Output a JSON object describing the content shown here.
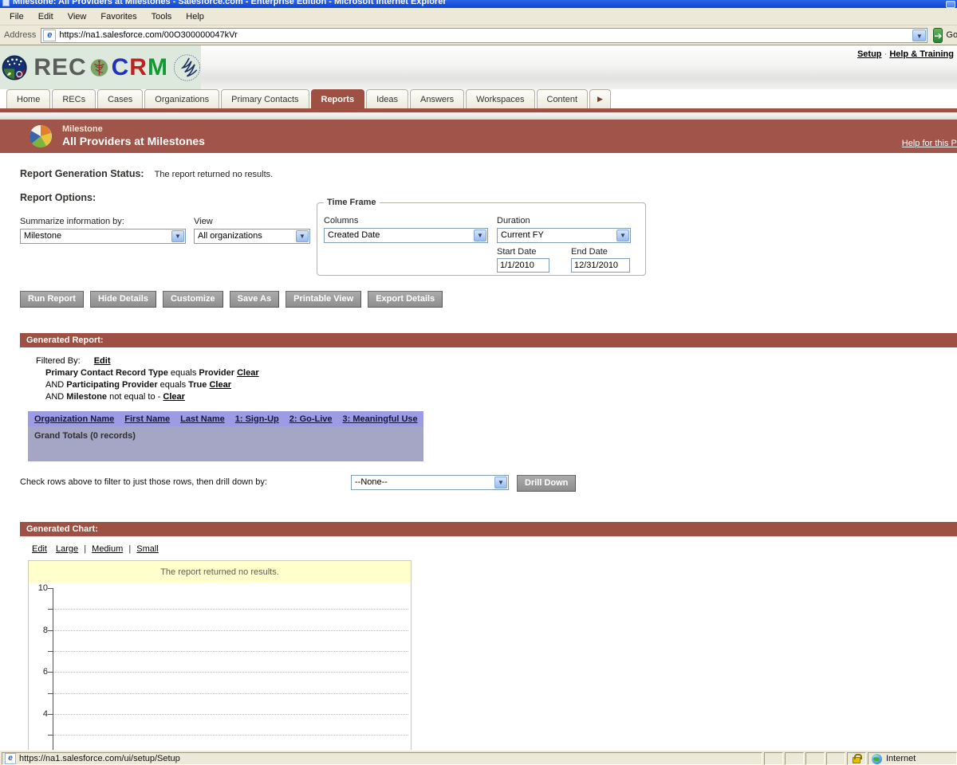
{
  "window": {
    "title": "Milestone: All Providers at Milestones - Salesforce.com - Enterprise Edition - Microsoft Internet Explorer",
    "menu_items": [
      "File",
      "Edit",
      "View",
      "Favorites",
      "Tools",
      "Help"
    ],
    "address_label": "Address",
    "address_url": "https://na1.salesforce.com/00O300000047kVr",
    "go_label": "Go"
  },
  "header": {
    "logo_rec": "REC",
    "logo_crm_c": "C",
    "logo_crm_r": "R",
    "logo_crm_m": "M",
    "setup_link": "Setup",
    "link_sep": "·",
    "help_training_link": "Help & Training"
  },
  "tabs": [
    {
      "label": "Home"
    },
    {
      "label": "RECs"
    },
    {
      "label": "Cases"
    },
    {
      "label": "Organizations"
    },
    {
      "label": "Primary Contacts"
    },
    {
      "label": "Reports"
    },
    {
      "label": "Ideas"
    },
    {
      "label": "Answers"
    },
    {
      "label": "Workspaces"
    },
    {
      "label": "Content"
    }
  ],
  "tabs_more_arrow": "▶",
  "banner": {
    "category": "Milestone",
    "title": "All Providers at Milestones",
    "help_link": "Help for this Pa"
  },
  "status_section": {
    "label": "Report Generation Status:",
    "value": "The report returned no results."
  },
  "report_options": {
    "heading": "Report Options:",
    "summarize_label": "Summarize information by:",
    "summarize_value": "Milestone",
    "view_label": "View",
    "view_value": "All organizations",
    "timeframe_legend": "Time Frame",
    "columns_label": "Columns",
    "columns_value": "Created Date",
    "duration_label": "Duration",
    "duration_value": "Current FY",
    "start_date_label": "Start Date",
    "start_date_value": "1/1/2010",
    "end_date_label": "End Date",
    "end_date_value": "12/31/2010"
  },
  "toolbar": {
    "buttons": [
      "Run Report",
      "Hide Details",
      "Customize",
      "Save As",
      "Printable View",
      "Export Details"
    ]
  },
  "generated_report": {
    "heading": "Generated Report:",
    "filtered_by_label": "Filtered By:",
    "edit_link": "Edit",
    "filters": [
      {
        "prefix": "",
        "field": "Primary Contact Record Type",
        "op": "equals",
        "value": "Provider",
        "clear": "Clear"
      },
      {
        "prefix": "AND",
        "field": "Participating Provider",
        "op": "equals",
        "value": "True",
        "clear": "Clear"
      },
      {
        "prefix": "AND",
        "field": "Milestone",
        "op": "not equal to -",
        "value": "",
        "clear": "Clear"
      }
    ],
    "table": {
      "columns": [
        "Organization Name",
        "First Name",
        "Last Name",
        "1: Sign-Up",
        "2: Go-Live",
        "3: Meaningful Use"
      ],
      "grand_totals": "Grand Totals (0 records)"
    },
    "drill": {
      "text": "Check rows above to filter to just those rows, then drill down by:",
      "select_value": "--None--",
      "button": "Drill Down"
    }
  },
  "generated_chart": {
    "heading": "Generated Chart:",
    "edit_link": "Edit",
    "size_large": "Large",
    "size_medium": "Medium",
    "size_small": "Small",
    "size_sep": "|",
    "notice": "The report returned no results.",
    "y_labels": [
      "10",
      "8",
      "6",
      "4"
    ],
    "chart": {
      "type": "bar",
      "series": [],
      "categories": [],
      "y_ticks": [
        3,
        4,
        5,
        6,
        7,
        8,
        9,
        10
      ],
      "y_tick_labels_shown": [
        4,
        6,
        8,
        10
      ],
      "ylim_visible": [
        3,
        10
      ],
      "grid": "dotted-horizontal",
      "message": "The report returned no results."
    }
  },
  "statusbar": {
    "url": "https://na1.salesforce.com/ui/setup/Setup",
    "zone": "Internet"
  }
}
